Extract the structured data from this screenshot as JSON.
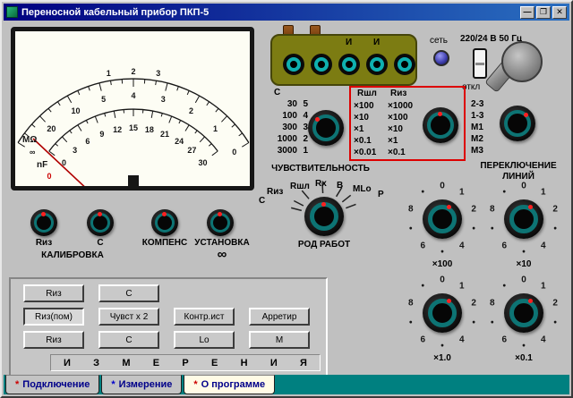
{
  "window": {
    "title": "Переносной кабельный прибор ПКП-5"
  },
  "icons": {
    "minimize": "—",
    "maximize": "❐",
    "close": "✕"
  },
  "meter": {
    "top_scale": [
      "1",
      "2",
      "3"
    ],
    "mohm_scale": [
      "∞",
      "20",
      "10",
      "5",
      "4",
      "3",
      "2",
      "1",
      "0"
    ],
    "nf_scale": [
      "0",
      "3",
      "6",
      "9",
      "12",
      "15",
      "18",
      "21",
      "24",
      "27",
      "30"
    ],
    "unit_mohm": "МΩ",
    "unit_nf": "nF",
    "zero_mark": "0"
  },
  "connector": {
    "pin_labels": [
      "И",
      "И"
    ]
  },
  "power": {
    "net_label": "сеть",
    "voltage_label": "220/24 В 50 Гц",
    "off_label": "откл"
  },
  "sensitivity": {
    "header": "С",
    "rows": [
      [
        "30",
        "5"
      ],
      [
        "100",
        "4"
      ],
      [
        "300",
        "3"
      ],
      [
        "1000",
        "2"
      ],
      [
        "3000",
        "1"
      ]
    ],
    "label": "ЧУВСТВИТЕЛЬНОСТЬ"
  },
  "multiplier": {
    "header_shl": "Rшл",
    "header_iz": "Rиз",
    "rows": [
      [
        "×100",
        "×1000"
      ],
      [
        "×10",
        "×100"
      ],
      [
        "×1",
        "×10"
      ],
      [
        "×0.1",
        "×1"
      ],
      [
        "×0.01",
        "×0.1"
      ]
    ]
  },
  "line_switch": {
    "rows": [
      "2-3",
      "1-3",
      "M1",
      "M2",
      "M3"
    ],
    "label1": "ПЕРЕКЛЮЧЕНИЕ",
    "label2": "ЛИНИЙ"
  },
  "mode": {
    "side_label": "С",
    "labels": [
      "Rиз",
      "Rшл",
      "Rх",
      "В",
      "МLo",
      "Р"
    ],
    "label": "РОД РАБОТ"
  },
  "small_knobs": {
    "k1": "Rиз",
    "k1b": "КАЛИБРОВКА",
    "k2": "С",
    "k3": "КОМПЕНС",
    "k4": "УСТАНОВКА",
    "k4b": "∞"
  },
  "dials": {
    "digits": [
      "0",
      "1",
      "2",
      "•",
      "4",
      "•",
      "6",
      "•",
      "8",
      "•"
    ],
    "labels": [
      "×100",
      "×10",
      "×1.0",
      "×0.1"
    ]
  },
  "buttons": {
    "col1": [
      "Rиз",
      "Rиз(пом)",
      "Rиз"
    ],
    "col2": [
      "С",
      "Чувст х 2",
      "С"
    ],
    "col3": [
      "Контр.ист",
      "Lo"
    ],
    "col4": [
      "Арретир",
      "М"
    ]
  },
  "letters": [
    "И",
    "З",
    "М",
    "Е",
    "Р",
    "Е",
    "Н",
    "И",
    "Я"
  ],
  "tabs": [
    {
      "star": "*",
      "star_color": "#cc0000",
      "label": "Подключение",
      "active": false
    },
    {
      "star": "*",
      "star_color": "#0000cc",
      "label": "Измерение",
      "active": false
    },
    {
      "star": "*",
      "star_color": "#cc0000",
      "label": "О программе",
      "active": true
    }
  ],
  "colors": {
    "panel": "#c0c0c0",
    "teal": "#008080",
    "highlight": "#dd0000",
    "knob_ring": "#0d7474",
    "olive": "#7c7c12"
  }
}
